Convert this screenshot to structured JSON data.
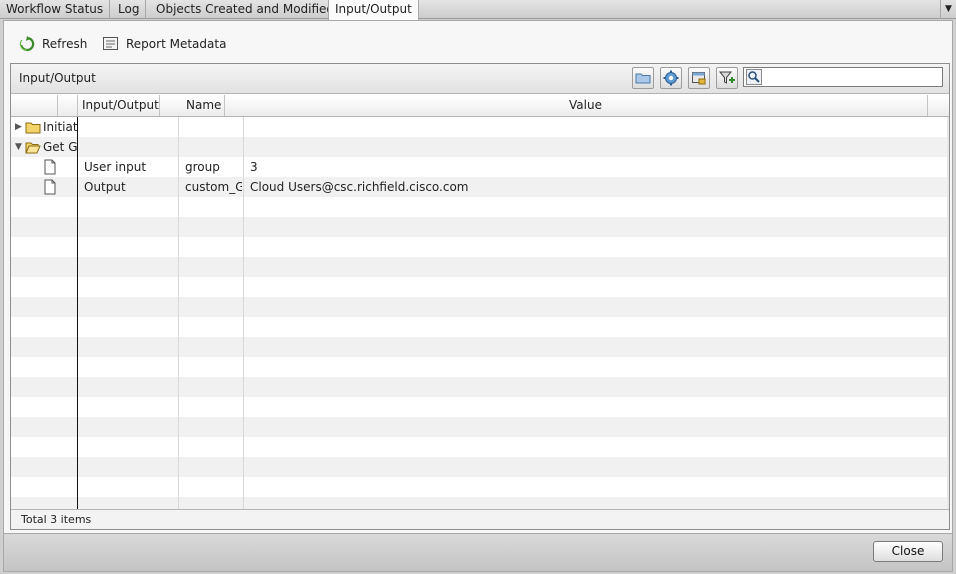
{
  "tabs": [
    {
      "label": "Workflow Status",
      "active": false
    },
    {
      "label": "Log",
      "active": false
    },
    {
      "label": "Objects Created and Modified",
      "active": false
    },
    {
      "label": "Input/Output",
      "active": true
    }
  ],
  "toolbar": {
    "refresh_label": "Refresh",
    "report_metadata_label": "Report Metadata"
  },
  "panel": {
    "title": "Input/Output",
    "search": {
      "value": "",
      "placeholder": ""
    },
    "header_icons": [
      "folder-icon",
      "settings-gear-icon",
      "export-icon",
      "add-filter-icon"
    ]
  },
  "columns": [
    "Input/Output",
    "Name",
    "Value"
  ],
  "rows": [
    {
      "type": "group",
      "expanded": false,
      "label": "Initiati",
      "icon": "folder-closed-icon"
    },
    {
      "type": "group",
      "expanded": true,
      "label": "Get Gr",
      "icon": "folder-open-icon"
    },
    {
      "type": "item",
      "icon": "document-icon",
      "io": "User input",
      "name": "group",
      "value": "3"
    },
    {
      "type": "item",
      "icon": "document-icon",
      "io": "Output",
      "name": "custom_Ge",
      "value": "Cloud Users@csc.richfield.cisco.com"
    }
  ],
  "footer": {
    "total": "Total 3 items"
  },
  "close_label": "Close",
  "colors": {
    "selected_tab_bg": "#fbfbfb",
    "alt_row": "#f1f1f1",
    "refresh_green": "#3a8a2a"
  }
}
